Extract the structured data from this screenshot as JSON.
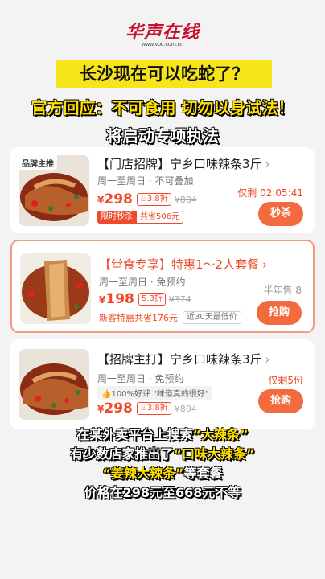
{
  "header": {
    "logo": "华声在线",
    "logo_url": "www.voc.com.cn",
    "headline": "长沙现在可以吃蛇了？",
    "sub1": "官方回应：不可食用 切勿以身试法！",
    "sub2": "将启动专项执法"
  },
  "listings": [
    {
      "badge": "品牌主推",
      "title": "【门店招牌】宁乡口味辣条3斤",
      "meta": "周一至周日 · 不可叠加",
      "price_symbol": "¥",
      "price": "298",
      "discount": "3.8折",
      "original_price": "¥804",
      "promo_tag": "限时秒杀",
      "promo_saving": "共省506元",
      "right_info": "仅剩 02:05:41",
      "button": "秒杀"
    },
    {
      "title": "【堂食专享】特惠1～2人套餐",
      "meta": "周一至周日 · 免预约",
      "price_symbol": "¥",
      "price": "198",
      "discount": "5.3折",
      "original_price": "¥374",
      "promo_text": "新客特惠共省176元",
      "promo_gray": "近30天最低价",
      "right_info": "半年售 8",
      "button": "抢购"
    },
    {
      "title": "【招牌主打】宁乡口味辣条3斤",
      "meta": "周一至周日 · 免预约",
      "praise": "100%好评 \"味道真的很好\"",
      "price_symbol": "¥",
      "price": "298",
      "discount": "3.8折",
      "original_price": "¥804",
      "right_info": "仅剩5份",
      "button": "抢购"
    }
  ],
  "caption": {
    "line1_pre": "在某外卖平台上搜索",
    "line1_hl": "“大辣条”",
    "line2_pre": "有少数店家推出了",
    "line2_hl": "“口味大辣条”",
    "line3_hl": "“姜辣大辣条”",
    "line3_post": "等套餐",
    "line4": "价格在298元至668元不等"
  },
  "colors": {
    "accent": "#f04a2a",
    "headline_bg": "#f7e51b",
    "logo": "#c8102e"
  }
}
